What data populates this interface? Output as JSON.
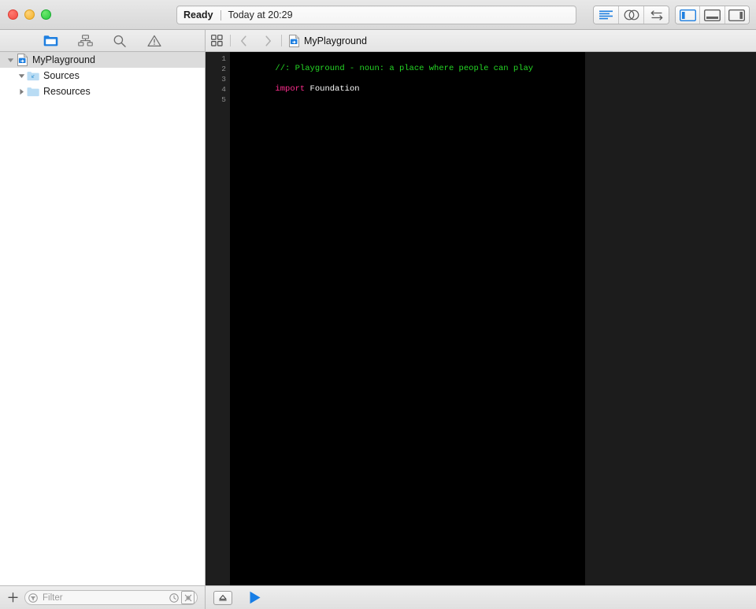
{
  "window": {
    "traffic_lights": [
      {
        "name": "close",
        "color": "#f24b42"
      },
      {
        "name": "minimize",
        "color": "#f2b12c"
      },
      {
        "name": "zoom",
        "color": "#27c93f"
      }
    ]
  },
  "status": {
    "state": "Ready",
    "detail": "Today at 20:29"
  },
  "toolbar": {
    "editor_modes": [
      {
        "name": "standard-editor",
        "icon": "lines-icon",
        "active": true
      },
      {
        "name": "assistant-editor",
        "icon": "venn-circles-icon",
        "active": false
      },
      {
        "name": "version-editor",
        "icon": "arrows-swap-icon",
        "active": false
      }
    ],
    "view_toggles": [
      {
        "name": "navigator-panel",
        "icon": "left-panel-icon",
        "active": true
      },
      {
        "name": "debug-panel",
        "icon": "bottom-panel-icon",
        "active": false
      },
      {
        "name": "utilities-panel",
        "icon": "right-panel-icon",
        "active": false
      }
    ]
  },
  "navigator": {
    "tabs": [
      {
        "name": "project-navigator",
        "icon": "folder-icon",
        "active": true
      },
      {
        "name": "symbol-navigator",
        "icon": "hierarchy-icon",
        "active": false
      },
      {
        "name": "find-navigator",
        "icon": "search-icon",
        "active": false
      },
      {
        "name": "issue-navigator",
        "icon": "warning-triangle-icon",
        "active": false
      }
    ],
    "tree": [
      {
        "label": "MyPlayground",
        "icon": "playground-file-icon",
        "depth": 0,
        "expanded": true,
        "selected": true
      },
      {
        "label": "Sources",
        "icon": "sources-folder-icon",
        "depth": 1,
        "expanded": true,
        "selected": false
      },
      {
        "label": "Resources",
        "icon": "folder-icon",
        "depth": 1,
        "expanded": false,
        "selected": false
      }
    ],
    "filter": {
      "placeholder": "Filter",
      "value": "",
      "add_label": "+",
      "toggles": [
        {
          "name": "recent-filter",
          "icon": "clock-icon"
        },
        {
          "name": "source-control-filter",
          "icon": "boxed-x-icon"
        }
      ]
    }
  },
  "jumpbar": {
    "related_items_icon": "grid-squares-icon",
    "back_icon": "chevron-left-icon",
    "forward_icon": "chevron-right-icon",
    "file_icon": "playground-file-icon",
    "file_name": "MyPlayground"
  },
  "editor": {
    "line_numbers": [
      "1",
      "2",
      "3",
      "4",
      "5"
    ],
    "lines": [
      {
        "number": "1",
        "tokens": [
          {
            "text": "//: Playground - noun: a place where people can play",
            "type": "comment"
          }
        ]
      },
      {
        "number": "2",
        "tokens": []
      },
      {
        "number": "3",
        "tokens": [
          {
            "text": "import",
            "type": "keyword"
          },
          {
            "text": " Foundation",
            "type": "plain"
          }
        ]
      },
      {
        "number": "4",
        "tokens": []
      },
      {
        "number": "5",
        "tokens": []
      }
    ],
    "background": "#000000",
    "gutter_background": "#1e1e1e",
    "results_background": "#1c1c1c",
    "comment_color": "#25d825",
    "keyword_color": "#ff2d8e",
    "plain_color": "#ffffff"
  },
  "debugbar": {
    "toggle_debug_area_icon": "debug-area-toggle-icon",
    "run_icon": "play-triangle-icon",
    "run_color": "#177ee6"
  }
}
